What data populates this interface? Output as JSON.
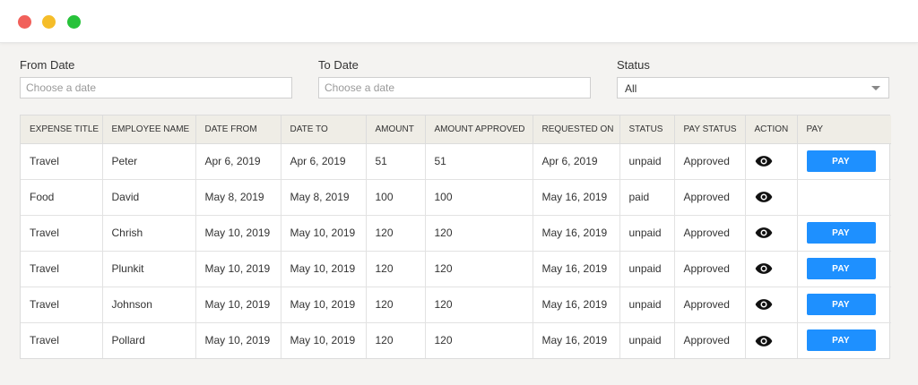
{
  "window": {
    "controls": {
      "close_color": "#f1605a",
      "minimize_color": "#f5bd29",
      "maximize_color": "#27c23a"
    }
  },
  "filters": {
    "from_date": {
      "label": "From Date",
      "placeholder": "Choose a date"
    },
    "to_date": {
      "label": "To Date",
      "placeholder": "Choose a date"
    },
    "status": {
      "label": "Status",
      "value": "All"
    }
  },
  "table": {
    "headers": [
      "EXPENSE TITLE",
      "EMPLOYEE NAME",
      "DATE FROM",
      "DATE TO",
      "AMOUNT",
      "AMOUNT APPROVED",
      "REQUESTED ON",
      "STATUS",
      "PAY STATUS",
      "ACTION",
      "PAY"
    ],
    "rows": [
      {
        "title": "Travel",
        "employee": "Peter",
        "date_from": "Apr 6, 2019",
        "date_to": "Apr 6, 2019",
        "amount": "51",
        "amount_approved": "51",
        "requested_on": "Apr 6, 2019",
        "status": "unpaid",
        "pay_status": "Approved",
        "action_icon": "eye-icon",
        "pay_label": "PAY"
      },
      {
        "title": "Food",
        "employee": "David",
        "date_from": "May 8, 2019",
        "date_to": "May 8, 2019",
        "amount": "100",
        "amount_approved": "100",
        "requested_on": "May 16, 2019",
        "status": "paid",
        "pay_status": "Approved",
        "action_icon": "eye-icon",
        "pay_label": ""
      },
      {
        "title": "Travel",
        "employee": "Chrish",
        "date_from": "May 10, 2019",
        "date_to": "May 10, 2019",
        "amount": "120",
        "amount_approved": "120",
        "requested_on": "May 16, 2019",
        "status": "unpaid",
        "pay_status": "Approved",
        "action_icon": "eye-icon",
        "pay_label": "PAY"
      },
      {
        "title": "Travel",
        "employee": "Plunkit",
        "date_from": "May 10, 2019",
        "date_to": "May 10, 2019",
        "amount": "120",
        "amount_approved": "120",
        "requested_on": "May 16, 2019",
        "status": "unpaid",
        "pay_status": "Approved",
        "action_icon": "eye-icon",
        "pay_label": "PAY"
      },
      {
        "title": "Travel",
        "employee": "Johnson",
        "date_from": "May 10, 2019",
        "date_to": "May 10, 2019",
        "amount": "120",
        "amount_approved": "120",
        "requested_on": "May 16, 2019",
        "status": "unpaid",
        "pay_status": "Approved",
        "action_icon": "eye-icon",
        "pay_label": "PAY"
      },
      {
        "title": "Travel",
        "employee": "Pollard",
        "date_from": "May 10, 2019",
        "date_to": "May 10, 2019",
        "amount": "120",
        "amount_approved": "120",
        "requested_on": "May 16, 2019",
        "status": "unpaid",
        "pay_status": "Approved",
        "action_icon": "eye-icon",
        "pay_label": "PAY"
      }
    ]
  },
  "colors": {
    "pay_button": "#1e90ff",
    "header_bg": "#efede6",
    "page_bg": "#f4f3f1"
  }
}
